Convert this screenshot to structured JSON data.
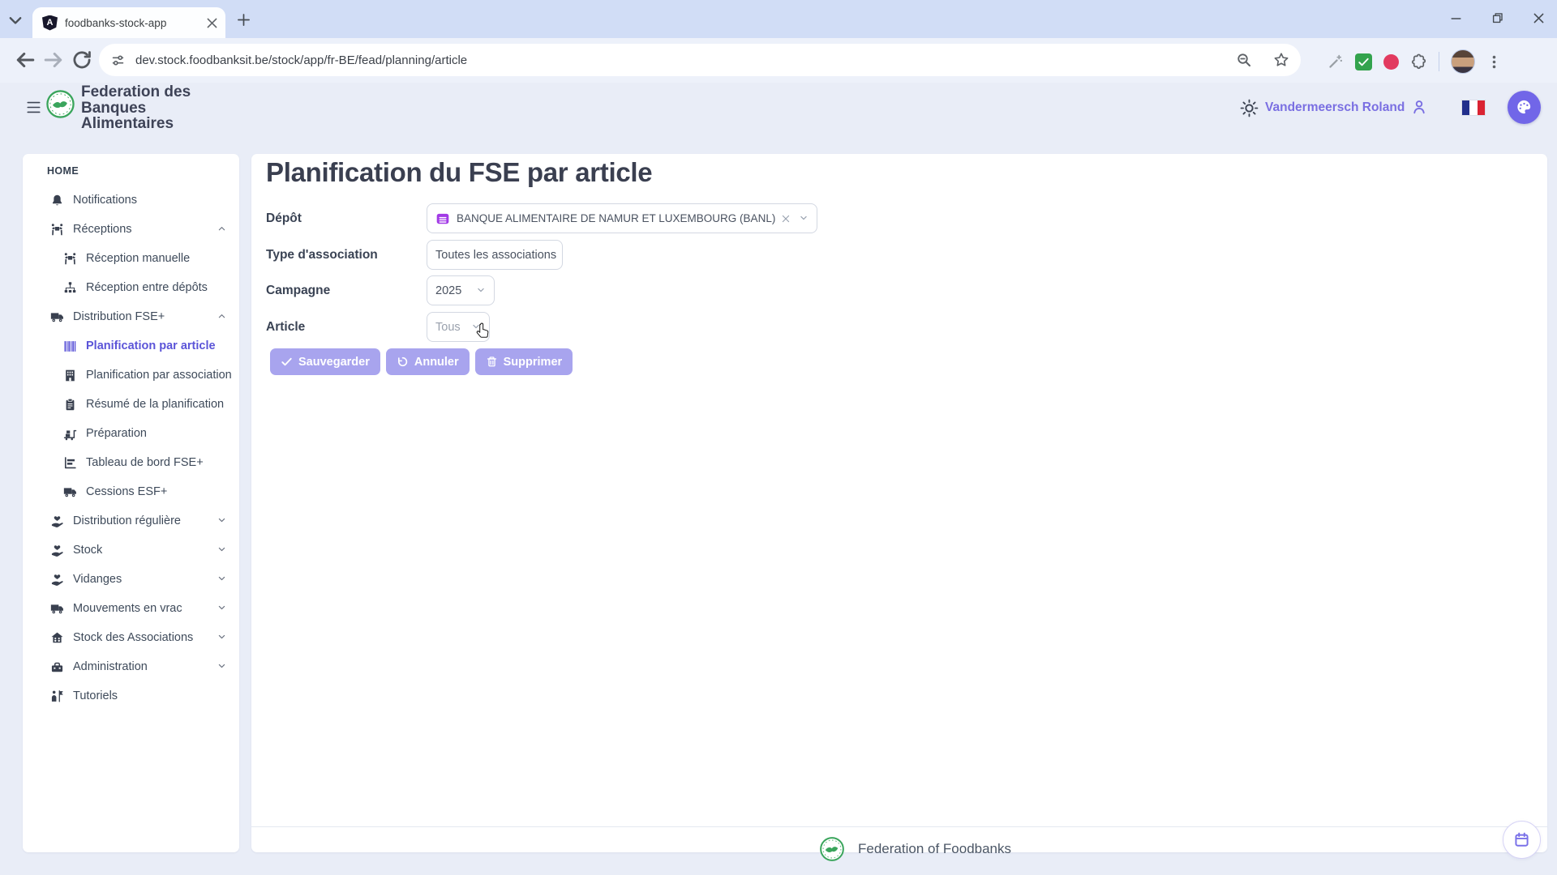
{
  "browser": {
    "tab_title": "foodbanks-stock-app",
    "url": "dev.stock.foodbanksit.be/stock/app/fr-BE/fead/planning/article"
  },
  "header": {
    "app_title": "Federation des Banques Alimentaires",
    "user_name": "Vandermeersch Roland"
  },
  "sidebar": {
    "section_label": "HOME",
    "items": [
      {
        "label": "Notifications",
        "icon": "bell",
        "level": 1
      },
      {
        "label": "Réceptions",
        "icon": "people-carry",
        "level": 1,
        "expanded": true
      },
      {
        "label": "Réception manuelle",
        "icon": "people-carry",
        "level": 2
      },
      {
        "label": "Réception entre dépôts",
        "icon": "sitemap",
        "level": 2
      },
      {
        "label": "Distribution FSE+",
        "icon": "truck",
        "level": 1,
        "expanded": true
      },
      {
        "label": "Planification par article",
        "icon": "barcode",
        "level": 2,
        "active": true
      },
      {
        "label": "Planification par association",
        "icon": "building",
        "level": 2
      },
      {
        "label": "Résumé de la planification",
        "icon": "clipboard",
        "level": 2
      },
      {
        "label": "Préparation",
        "icon": "cart",
        "level": 2
      },
      {
        "label": "Tableau de bord FSE+",
        "icon": "chart",
        "level": 2
      },
      {
        "label": "Cessions ESF+",
        "icon": "truck",
        "level": 2
      },
      {
        "label": "Distribution régulière",
        "icon": "hand-heart",
        "level": 1,
        "collapsed": true
      },
      {
        "label": "Stock",
        "icon": "hand-heart",
        "level": 1,
        "collapsed": true
      },
      {
        "label": "Vidanges",
        "icon": "hand-heart",
        "level": 1,
        "collapsed": true
      },
      {
        "label": "Mouvements en vrac",
        "icon": "truck",
        "level": 1,
        "collapsed": true
      },
      {
        "label": "Stock des Associations",
        "icon": "house-users",
        "level": 1,
        "collapsed": true
      },
      {
        "label": "Administration",
        "icon": "toolbox",
        "level": 1,
        "collapsed": true
      },
      {
        "label": "Tutoriels",
        "icon": "tutorial",
        "level": 1
      }
    ]
  },
  "main": {
    "title": "Planification du FSE par article",
    "form": {
      "depot": {
        "label": "Dépôt",
        "value": "BANQUE ALIMENTAIRE DE NAMUR ET LUXEMBOURG (BANL)",
        "icon": "garage"
      },
      "association_type": {
        "label": "Type d'association",
        "value": "Toutes les associations"
      },
      "campaign": {
        "label": "Campagne",
        "value": "2025"
      },
      "article": {
        "label": "Article",
        "value": "Tous"
      }
    },
    "buttons": {
      "save": "Sauvegarder",
      "cancel": "Annuler",
      "delete": "Supprimer"
    }
  },
  "footer": {
    "text": "Federation of Foodbanks"
  },
  "icons": {
    "tab_favicon": "angular-shield",
    "url_left": "tune",
    "url_right": [
      "magnifier-minus",
      "star"
    ],
    "extensions": [
      "wand",
      "green-check",
      "red-dot",
      "puzzle"
    ],
    "header_right": [
      "sun",
      "person",
      "flag-fr",
      "palette"
    ],
    "floating_button": "calendar",
    "pointer": "hand-cursor"
  },
  "colors": {
    "accent_purple": "#5b54d8",
    "button_lavender": "#a8a4ee",
    "depot_icon_purple": "#a23ae6",
    "logo_green": "#3aa55c",
    "ext_green": "#33a34d",
    "ext_red": "#e23a5f",
    "flag_blue": "#212f8c",
    "flag_red": "#da2332",
    "page_bg": "#e9edf7",
    "tabstrip_bg": "#d1ddf6",
    "toolbar_bg": "#edf1fa"
  }
}
